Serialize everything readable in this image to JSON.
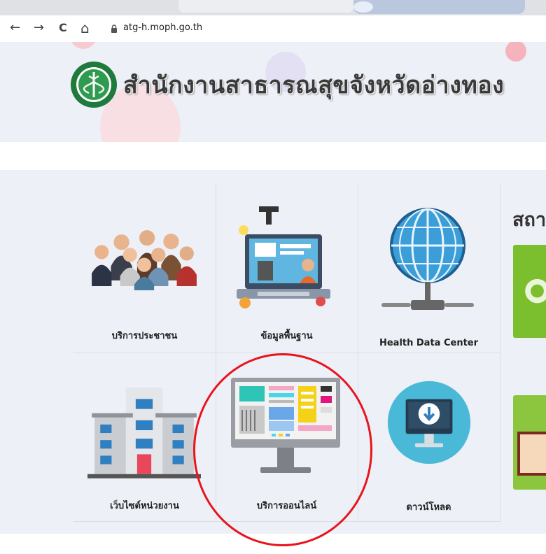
{
  "browser": {
    "url": "atg-h.moph.go.th",
    "back_glyph": "←",
    "forward_glyph": "→",
    "reload_glyph": "C",
    "home_glyph": "⌂"
  },
  "header": {
    "site_title": "สำนักงานสาธารณสุขจังหวัดอ่างทอง"
  },
  "menu": {
    "items": [
      {
        "label": "บริการประชาชน",
        "icon": "people-group-icon"
      },
      {
        "label": "ข้อมูลพื้นฐาน",
        "icon": "computer-education-icon"
      },
      {
        "label": "Health Data Center",
        "icon": "globe-network-icon"
      },
      {
        "label": "เว็บไซต์หน่วยงาน",
        "icon": "office-building-icon"
      },
      {
        "label": "บริการออนไลน์",
        "icon": "desktop-monitor-icon"
      },
      {
        "label": "ดาวน์โหลด",
        "icon": "download-monitor-icon"
      }
    ]
  },
  "side": {
    "title": "สถา"
  },
  "colors": {
    "highlight": "#e8141c",
    "content_bg": "#eef0f8",
    "green_card": "#7bbf2e"
  }
}
